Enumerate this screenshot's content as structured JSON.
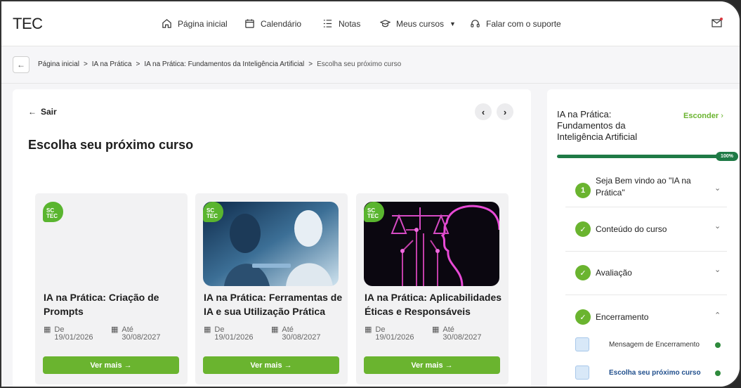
{
  "nav": {
    "logo": "TEC",
    "items": [
      {
        "label": "Página inicial",
        "icon": "home-icon"
      },
      {
        "label": "Calendário",
        "icon": "calendar-icon"
      },
      {
        "label": "Notas",
        "icon": "list-icon"
      },
      {
        "label": "Meus cursos",
        "icon": "graduation-cap-icon"
      },
      {
        "label": "Falar com o suporte",
        "icon": "headset-icon"
      }
    ],
    "mail_icon": "mail-icon"
  },
  "breadcrumb": {
    "items": [
      "Página inicial",
      "IA na Prática",
      "IA na Prática: Fundamentos da Inteligência Artificial"
    ],
    "current": "Escolha seu próximo curso",
    "separator": ">"
  },
  "main": {
    "exit_label": "Sair",
    "title": "Escolha seu próximo curso",
    "cards": [
      {
        "badge": "SC TEC",
        "title": "IA na Prática: Criação de Prompts",
        "from_label": "De",
        "from_date": "19/01/2026",
        "to_label": "Até",
        "to_date": "30/08/2027",
        "button": "Ver mais →"
      },
      {
        "badge": "SC TEC",
        "title": "IA na Prática: Ferramentas de IA e sua Utilização Prática",
        "from_label": "De",
        "from_date": "19/01/2026",
        "to_label": "Até",
        "to_date": "30/08/2027",
        "button": "Ver mais →"
      },
      {
        "badge": "SC TEC",
        "title": "IA na Prática: Aplicabilidades Éticas e Responsáveis",
        "from_label": "De",
        "from_date": "19/01/2026",
        "to_label": "Até",
        "to_date": "30/08/2027",
        "button": "Ver mais →"
      }
    ]
  },
  "sidebar": {
    "title": "IA na Prática: Fundamentos da Inteligência Artificial",
    "hide_label": "Esconder",
    "progress_label": "100%",
    "progress": 1.0,
    "modules": [
      {
        "marker": "1",
        "label": "Seja Bem vindo ao \"IA na Prática\"",
        "expanded": false
      },
      {
        "marker": "✓",
        "label": "Conteúdo do curso",
        "expanded": false
      },
      {
        "marker": "✓",
        "label": "Avaliação",
        "expanded": false
      },
      {
        "marker": "✓",
        "label": "Encerramento",
        "expanded": true
      }
    ],
    "subitems": [
      {
        "label": "Mensagem de Encerramento"
      },
      {
        "label": "Escolha seu próximo curso"
      }
    ]
  },
  "colors": {
    "accent": "#6ab42f",
    "progress": "#1f7a46",
    "active_link": "#1f4e8c"
  }
}
